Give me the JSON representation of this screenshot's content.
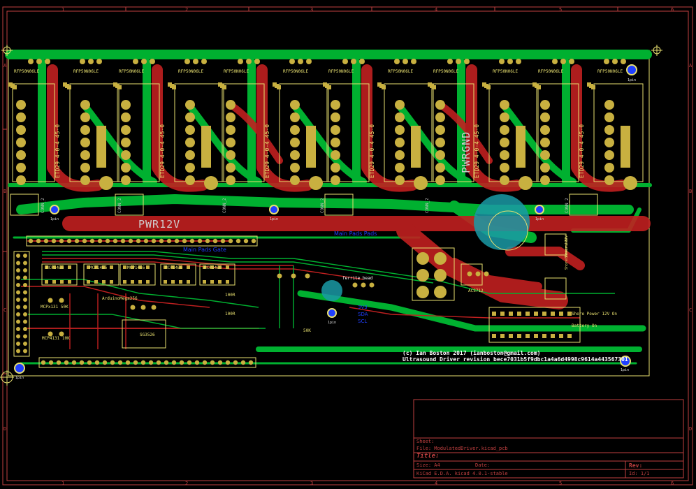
{
  "mosfet_label": "RFP50N06LE",
  "transformer_label": "ETD29 4-0-4 45-0",
  "connector_label": "CONN_2",
  "hole_label": "1pin",
  "power_nets": {
    "pwr12v": "PWR12V",
    "pwrgnd": "PWRGND"
  },
  "blue_notes": {
    "main_pads": "Main Pads Pads",
    "mains_gate": "Main Pads Gate"
  },
  "chips": [
    "MCP14E6",
    "MCP14E6",
    "MCP14E6",
    "MCP14E6",
    "MCP14E6"
  ],
  "parts": {
    "arduino": "ArduinoMega256",
    "sg3526": "SG3526",
    "mcp41_50k": "MCPx131 50K",
    "mcp41_10k": "MCP4131 10K",
    "ferrite": "ferrite bead",
    "acs712": "ACS712",
    "res_100r_a": "100R",
    "res_100r_b": "100R",
    "res_50k": "50K",
    "sig_3v3": "3V3",
    "sig_sda": "SDA",
    "sig_scl": "SCL",
    "shore_12v": "Shore Power 12V",
    "battery_12v": "Battery 12V",
    "shore_on": "Shore Power 12V On",
    "battery_on": "Battery On"
  },
  "copyright": "(c) Ian Boston  2017  (ianboston@gmail.com)",
  "revision_line": "Ultrasound Driver revision bece7031b5f9dbc1a4a6d4998c9614a443567301",
  "title_block": {
    "sheet_label": "Sheet:",
    "file_label": "File: ModulatedDriver.kicad_pcb",
    "title_label": "Title:",
    "size_label": "Size: A4",
    "date_label": "Date:",
    "kicad_label": "KiCad E.D.A.  kicad 4.0.1-stable",
    "rev_label": "Rev:",
    "id_label": "Id: 1/1"
  },
  "frame_cols": [
    "1",
    "2",
    "3",
    "4",
    "5",
    "6"
  ],
  "frame_rows": [
    "A",
    "B",
    "C",
    "D"
  ],
  "colors": {
    "copper_top": "#c02020",
    "copper_bottom": "#00b030",
    "silkscreen": "#e8e070",
    "frame": "#c04040",
    "pad": "#c8b040",
    "via": "#2040ff",
    "board_bg": "#000000"
  }
}
